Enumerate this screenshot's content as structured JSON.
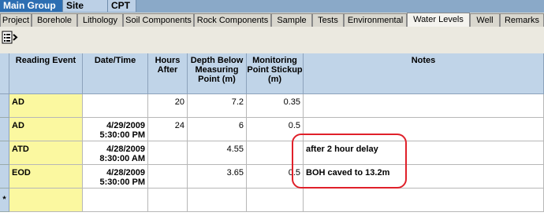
{
  "group_tabs": [
    {
      "label": "Main Group",
      "active": true
    },
    {
      "label": "Site Map",
      "active": false
    },
    {
      "label": "CPT",
      "active": false
    }
  ],
  "page_tabs": [
    {
      "label": "Project",
      "active": false
    },
    {
      "label": "Borehole",
      "active": false
    },
    {
      "label": "Lithology",
      "active": false
    },
    {
      "label": "Soil Components",
      "active": false
    },
    {
      "label": "Rock Components",
      "active": false
    },
    {
      "label": "Sample",
      "active": false
    },
    {
      "label": "Tests",
      "active": false
    },
    {
      "label": "Environmental",
      "active": false
    },
    {
      "label": "Water Levels",
      "active": true
    },
    {
      "label": "Well",
      "active": false
    },
    {
      "label": "Remarks",
      "active": false
    }
  ],
  "toolbar": {
    "icon": "list-indent-icon"
  },
  "grid": {
    "columns": [
      {
        "label": "Reading Event"
      },
      {
        "label": "Date/Time"
      },
      {
        "label": "Hours After"
      },
      {
        "label": "Depth Below Measuring Point (m)"
      },
      {
        "label": "Monitoring Point Stickup (m)"
      },
      {
        "label": "Notes"
      }
    ],
    "rows": [
      {
        "event": "AD",
        "date": "",
        "time": "",
        "hours": "20",
        "depth": "7.2",
        "stickup": "0.35",
        "notes": ""
      },
      {
        "event": "AD",
        "date": "4/29/2009",
        "time": "5:30:00 PM",
        "hours": "24",
        "depth": "6",
        "stickup": "0.5",
        "notes": ""
      },
      {
        "event": "ATD",
        "date": "4/28/2009",
        "time": "8:30:00 AM",
        "hours": "",
        "depth": "4.55",
        "stickup": "",
        "notes": "after 2 hour delay"
      },
      {
        "event": "EOD",
        "date": "4/28/2009",
        "time": "5:30:00 PM",
        "hours": "",
        "depth": "3.65",
        "stickup": "0.5",
        "notes": "BOH caved to 13.2m"
      },
      {
        "event": "",
        "date": "",
        "time": "",
        "hours": "",
        "depth": "",
        "stickup": "",
        "notes": ""
      }
    ],
    "new_row_marker": "*"
  },
  "colors": {
    "highlight": "#e0202a",
    "event_cell": "#fbf8a0",
    "header": "#c0d4e8",
    "active_group_tab": "#2d6eb2"
  }
}
